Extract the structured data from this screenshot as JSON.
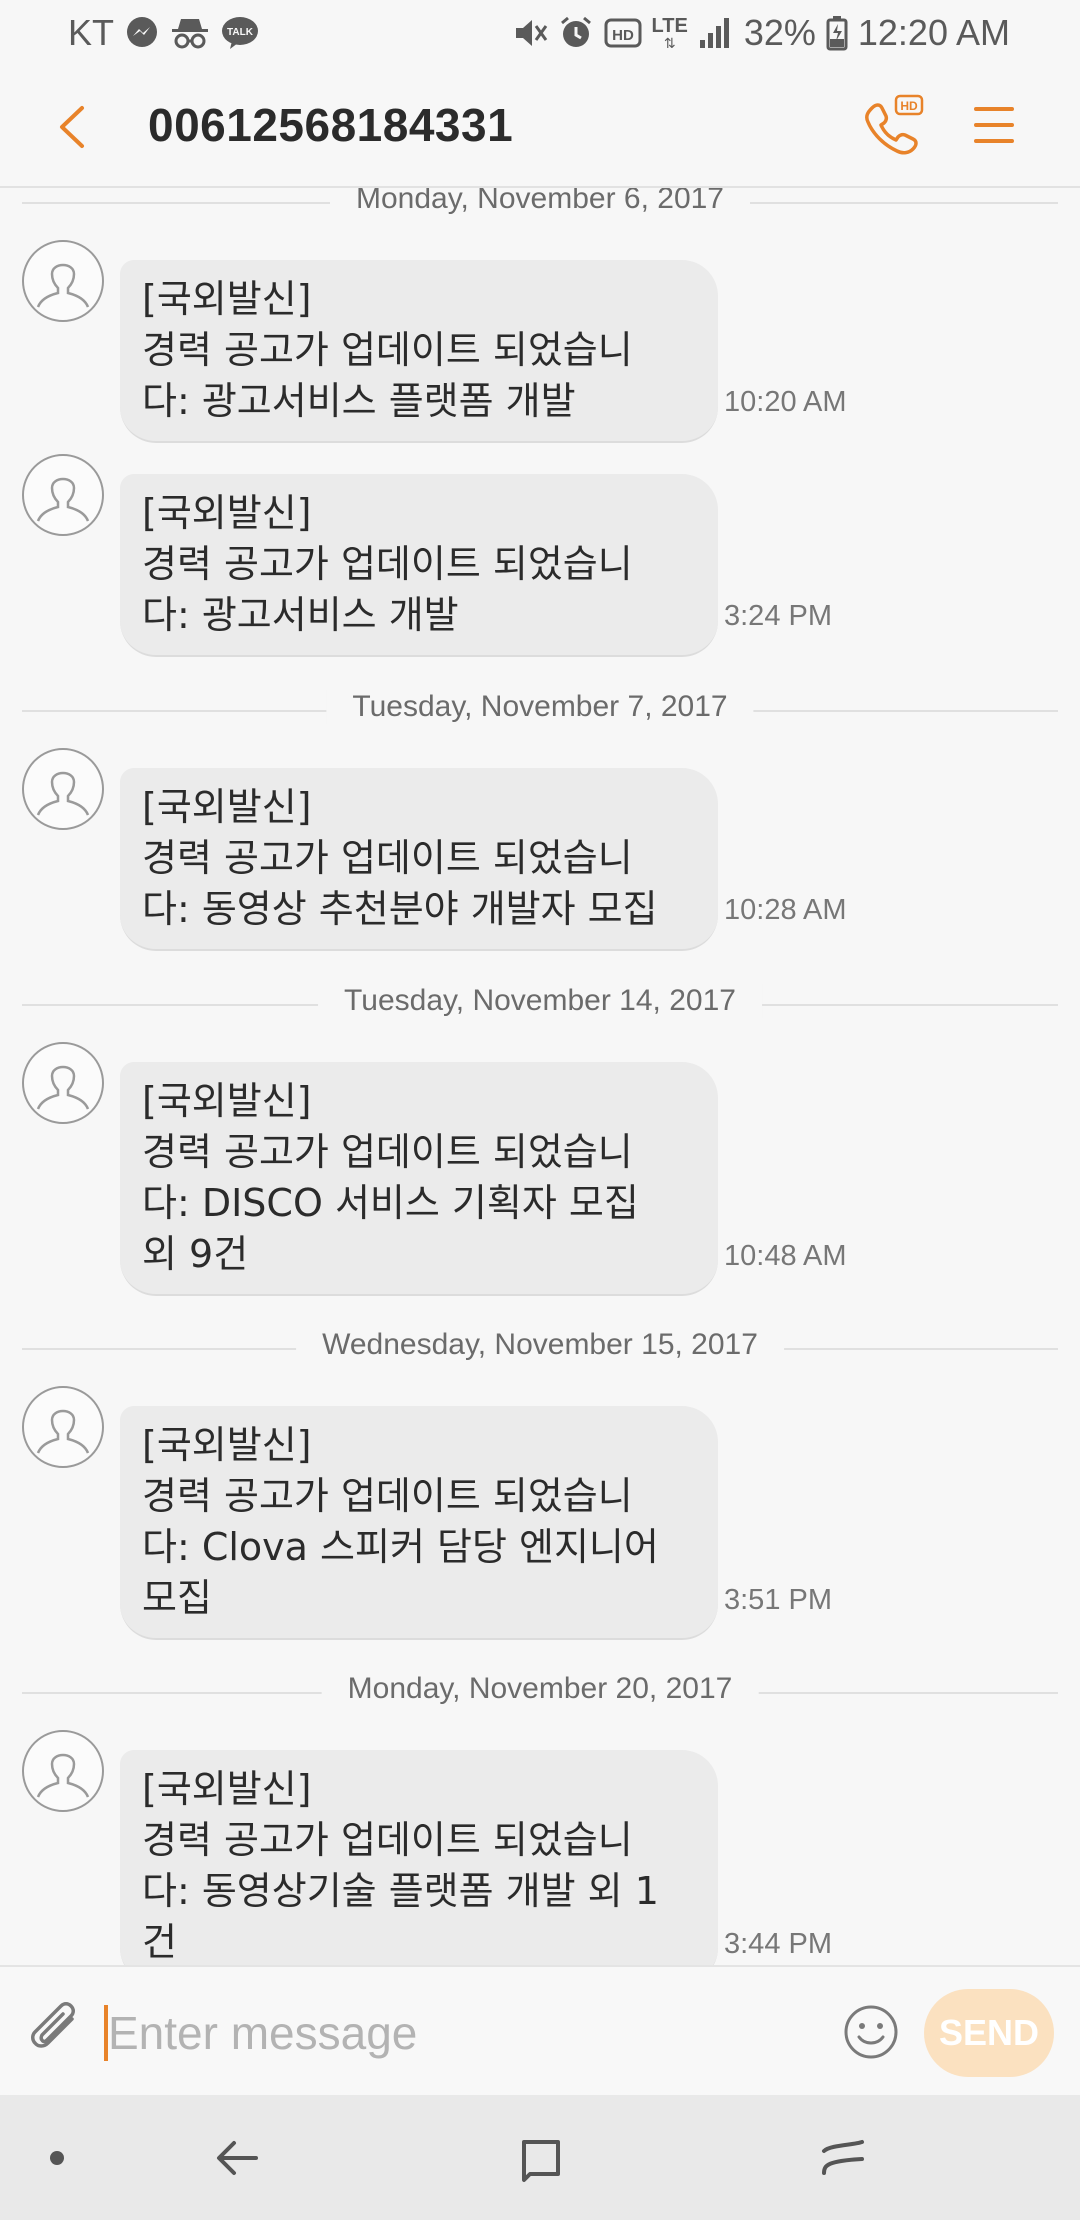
{
  "status_bar": {
    "carrier": "KT",
    "network": "LTE",
    "battery": "32%",
    "time": "12:20 AM"
  },
  "header": {
    "contact": "00612568184331",
    "accent_color": "#e8832a"
  },
  "messages": [
    {
      "date": "Monday, November 6, 2017",
      "header": "[국외발신]",
      "lines": [
        "경력 공고가 업데이트 되었습니",
        "다: 광고서비스 플랫폼 개발"
      ],
      "time": "10:20 AM"
    },
    {
      "header": "[국외발신]",
      "lines": [
        "경력 공고가 업데이트 되었습니",
        "다: 광고서비스 개발"
      ],
      "time": "3:24 PM"
    },
    {
      "date": "Tuesday, November 7, 2017",
      "header": "[국외발신]",
      "lines": [
        "경력 공고가 업데이트 되었습니",
        "다: 동영상 추천분야 개발자 모집"
      ],
      "time": "10:28 AM"
    },
    {
      "date": "Tuesday, November 14, 2017",
      "header": "[국외발신]",
      "lines": [
        "경력 공고가 업데이트 되었습니",
        "다: DISCO 서비스 기획자 모집",
        "외 9건"
      ],
      "time": "10:48 AM"
    },
    {
      "date": "Wednesday, November 15, 2017",
      "header": "[국외발신]",
      "lines": [
        "경력 공고가 업데이트 되었습니",
        "다: Clova 스피커 담당 엔지니어",
        "모집"
      ],
      "time": "3:51 PM"
    },
    {
      "date": "Monday, November 20, 2017",
      "header": "[국외발신]",
      "lines": [
        "경력 공고가 업데이트 되었습니",
        "다: 동영상기술 플랫폼 개발 외 1",
        "건"
      ],
      "time": "3:44 PM"
    }
  ],
  "composer": {
    "placeholder": "Enter message",
    "send_label": "SEND"
  },
  "icons": {
    "back": "chevron-left-icon",
    "call": "hd-call-icon",
    "menu": "menu-icon",
    "attach": "paperclip-icon",
    "emoji": "smiley-icon"
  }
}
